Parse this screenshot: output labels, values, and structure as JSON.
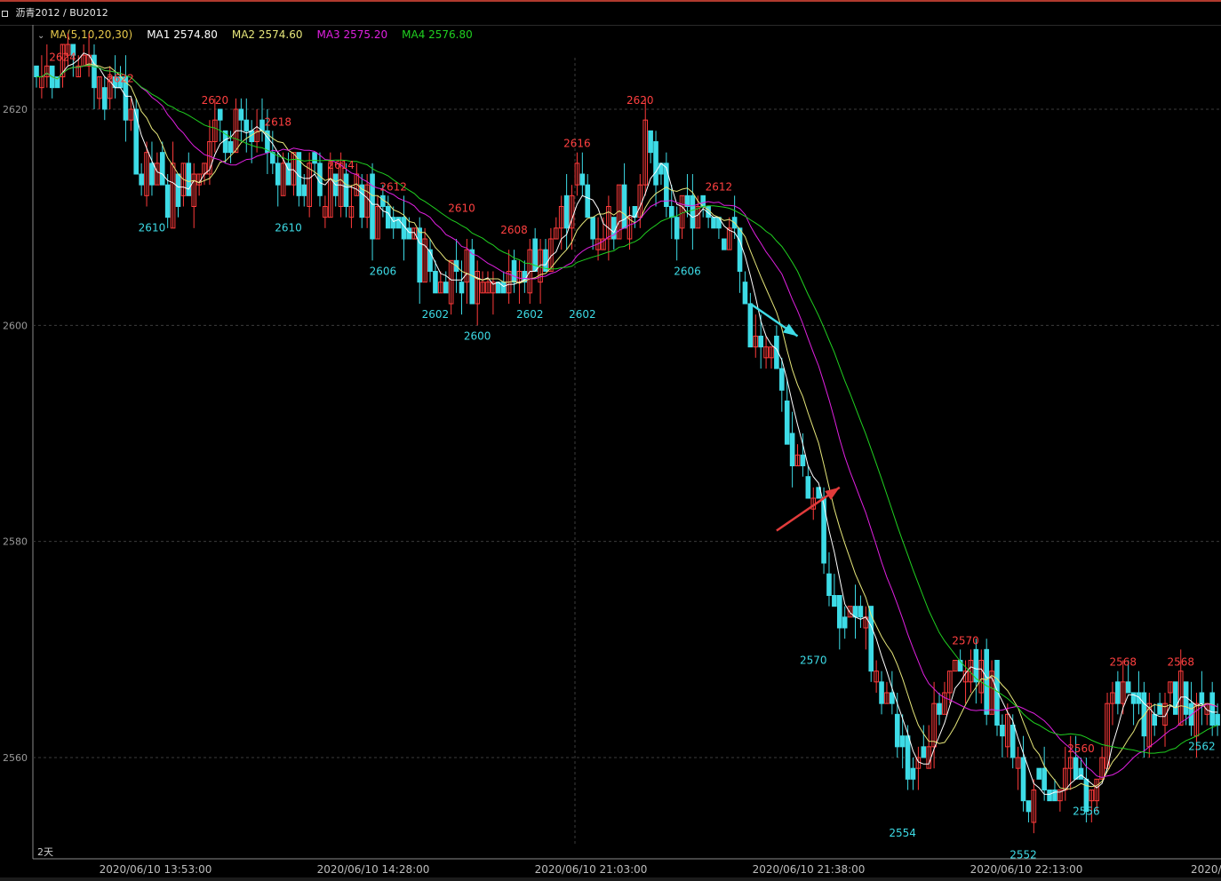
{
  "header": {
    "title": "沥青2012 / BU2012"
  },
  "legend": {
    "ma_params": "MA(5,10,20,30)",
    "ma1_label": "MA1 2574.80",
    "ma2_label": "MA2 2574.60",
    "ma3_label": "MA3 2575.20",
    "ma4_label": "MA4 2576.80",
    "ma1_color": "#ffffff",
    "ma2_color": "#e6e67a",
    "ma3_color": "#e020e0",
    "ma4_color": "#20d020"
  },
  "period_label": "2天",
  "chart_data": {
    "type": "candlestick",
    "y_range": [
      2551,
      2628
    ],
    "y_ticks": [
      2560,
      2580,
      2600,
      2620
    ],
    "grid": true,
    "x_labels": [
      "2020/06/10 13:53:00",
      "2020/06/10 14:28:00",
      "2020/06/10 21:03:00",
      "2020/06/10 21:38:00",
      "2020/06/10 22:13:00",
      "2020/"
    ],
    "colors": {
      "up": "#ff3b3b",
      "down": "#3ddbe6"
    },
    "high_annotations": [
      {
        "bar": 5,
        "value": 2624
      },
      {
        "bar": 16,
        "value": 2622
      },
      {
        "bar": 34,
        "value": 2620
      },
      {
        "bar": 46,
        "value": 2618
      },
      {
        "bar": 58,
        "value": 2614
      },
      {
        "bar": 68,
        "value": 2612
      },
      {
        "bar": 81,
        "value": 2610
      },
      {
        "bar": 91,
        "value": 2608
      },
      {
        "bar": 103,
        "value": 2616
      },
      {
        "bar": 115,
        "value": 2620
      },
      {
        "bar": 130,
        "value": 2612
      },
      {
        "bar": 177,
        "value": 2570
      },
      {
        "bar": 199,
        "value": 2560
      },
      {
        "bar": 207,
        "value": 2568
      },
      {
        "bar": 218,
        "value": 2568
      }
    ],
    "low_annotations": [
      {
        "bar": 22,
        "value": 2610
      },
      {
        "bar": 48,
        "value": 2610
      },
      {
        "bar": 66,
        "value": 2606
      },
      {
        "bar": 76,
        "value": 2602
      },
      {
        "bar": 84,
        "value": 2600
      },
      {
        "bar": 94,
        "value": 2602
      },
      {
        "bar": 104,
        "value": 2602
      },
      {
        "bar": 124,
        "value": 2606
      },
      {
        "bar": 148,
        "value": 2570
      },
      {
        "bar": 165,
        "value": 2554
      },
      {
        "bar": 188,
        "value": 2552
      },
      {
        "bar": 200,
        "value": 2556
      },
      {
        "bar": 222,
        "value": 2562
      }
    ],
    "close_anchors": [
      [
        0,
        2623
      ],
      [
        4,
        2624
      ],
      [
        8,
        2624
      ],
      [
        12,
        2622
      ],
      [
        16,
        2622
      ],
      [
        20,
        2614
      ],
      [
        24,
        2612
      ],
      [
        28,
        2613
      ],
      [
        32,
        2617
      ],
      [
        36,
        2618
      ],
      [
        40,
        2617
      ],
      [
        44,
        2615
      ],
      [
        48,
        2614
      ],
      [
        52,
        2613
      ],
      [
        56,
        2613
      ],
      [
        60,
        2612
      ],
      [
        64,
        2610
      ],
      [
        68,
        2610
      ],
      [
        72,
        2607
      ],
      [
        76,
        2604
      ],
      [
        80,
        2605
      ],
      [
        84,
        2604
      ],
      [
        88,
        2605
      ],
      [
        92,
        2604
      ],
      [
        96,
        2606
      ],
      [
        100,
        2610
      ],
      [
        103,
        2614
      ],
      [
        106,
        2608
      ],
      [
        110,
        2610
      ],
      [
        114,
        2612
      ],
      [
        116,
        2617
      ],
      [
        118,
        2613
      ],
      [
        122,
        2610
      ],
      [
        126,
        2610
      ],
      [
        130,
        2610
      ],
      [
        133,
        2608
      ],
      [
        135,
        2602
      ],
      [
        137,
        2598
      ],
      [
        140,
        2596
      ],
      [
        143,
        2591
      ],
      [
        146,
        2586
      ],
      [
        148,
        2585
      ],
      [
        150,
        2580
      ],
      [
        152,
        2574
      ],
      [
        155,
        2574
      ],
      [
        158,
        2571
      ],
      [
        161,
        2567
      ],
      [
        164,
        2561
      ],
      [
        166,
        2558
      ],
      [
        168,
        2560
      ],
      [
        171,
        2565
      ],
      [
        174,
        2567
      ],
      [
        177,
        2570
      ],
      [
        180,
        2567
      ],
      [
        183,
        2565
      ],
      [
        186,
        2561
      ],
      [
        189,
        2557
      ],
      [
        192,
        2555
      ],
      [
        195,
        2556
      ],
      [
        198,
        2559
      ],
      [
        200,
        2557
      ],
      [
        203,
        2562
      ],
      [
        206,
        2565
      ],
      [
        209,
        2564
      ],
      [
        212,
        2563
      ],
      [
        215,
        2565
      ],
      [
        218,
        2566
      ],
      [
        221,
        2563
      ],
      [
        224,
        2564
      ]
    ],
    "ma_series": [
      {
        "name": "MA1",
        "color": "#ffffff",
        "period": 5
      },
      {
        "name": "MA2",
        "color": "#e6e67a",
        "period": 10
      },
      {
        "name": "MA3",
        "color": "#e020e0",
        "period": 20
      },
      {
        "name": "MA4",
        "color": "#20d020",
        "period": 30
      }
    ],
    "arrows": [
      {
        "color": "#3ddbe6",
        "from": [
          136,
          2602
        ],
        "to": [
          145,
          2599
        ]
      },
      {
        "color": "#e23b3b",
        "from": [
          141,
          2581
        ],
        "to": [
          153,
          2585
        ]
      }
    ]
  }
}
